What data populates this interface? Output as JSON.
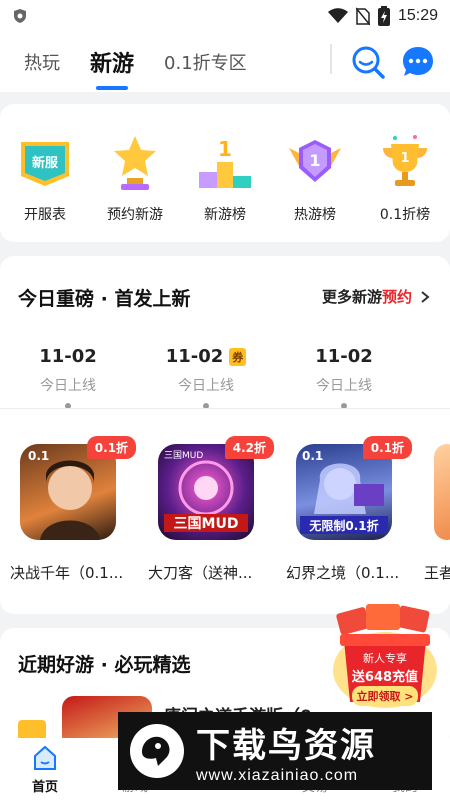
{
  "status_bar": {
    "time": "15:29"
  },
  "header": {
    "tabs": [
      {
        "label": "热玩"
      },
      {
        "label": "新游"
      },
      {
        "label": "0.1折专区"
      }
    ],
    "search_icon": "search-icon",
    "message_icon": "chat-icon"
  },
  "quick_links": [
    {
      "label": "开服表",
      "icon": "new-server-badge-icon",
      "badge_text": "新服"
    },
    {
      "label": "预约新游",
      "icon": "star-trophy-icon"
    },
    {
      "label": "新游榜",
      "icon": "podium-icon"
    },
    {
      "label": "热游榜",
      "icon": "winged-badge-icon"
    },
    {
      "label": "0.1折榜",
      "icon": "gold-cup-icon"
    }
  ],
  "today_section": {
    "title": "今日重磅 · 首发上新",
    "more_prefix": "更多新游",
    "more_highlight": "预约",
    "dates": [
      {
        "date": "11-02",
        "sub": "今日上线",
        "coupon": ""
      },
      {
        "date": "11-02",
        "sub": "今日上线",
        "coupon": "券"
      },
      {
        "date": "11-02",
        "sub": "今日上线",
        "coupon": ""
      }
    ],
    "games": [
      {
        "name": "决战千年（0.1...",
        "badge": "0.1折"
      },
      {
        "name": "大刀客（送神...",
        "badge": "4.2折"
      },
      {
        "name": "幻界之境（0.1...",
        "badge": "0.1折"
      },
      {
        "name": "王者",
        "badge": ""
      }
    ]
  },
  "recent_section": {
    "title": "近期好游 · 必玩精选",
    "partial_item_name": "唐门之道手游版（0"
  },
  "promo": {
    "line1": "新人专享",
    "line2": "送648充值",
    "button": "立即领取 >"
  },
  "bottom_nav": [
    {
      "label": "首页",
      "icon": "home-icon"
    },
    {
      "label": "游戏",
      "icon": "gamepad-icon"
    },
    {
      "label": "",
      "icon": "center-icon"
    },
    {
      "label": "交易",
      "icon": "trade-icon"
    },
    {
      "label": "我的",
      "icon": "user-icon"
    }
  ],
  "watermark": {
    "main": "下载鸟资源",
    "url": "www.xiazainiao.com"
  },
  "colors": {
    "accent": "#1677ff",
    "highlight_red": "#e8252b",
    "badge_red": "#f5423a",
    "background": "#f2f3f5"
  }
}
